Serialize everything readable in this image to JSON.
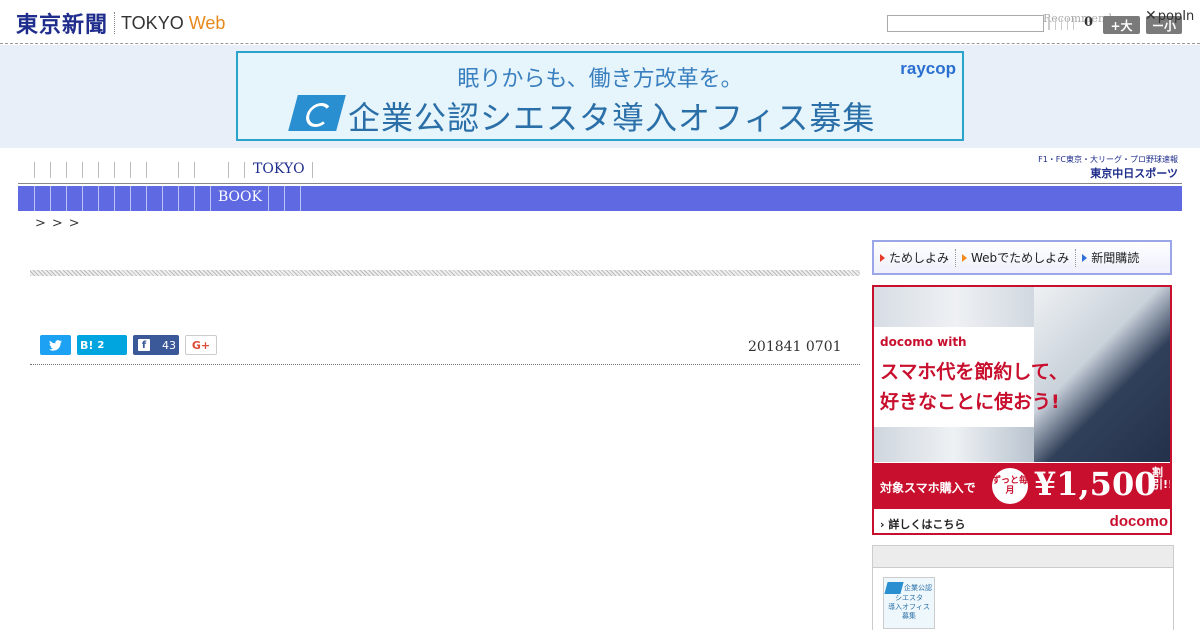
{
  "header": {
    "logo_jp": "東京新聞",
    "logo_en": "TOKYO",
    "logo_web": "Web",
    "search_value": "",
    "recommend": "Recommend",
    "count": "0",
    "size_up": "+大",
    "size_down": "ー小",
    "popin": "popIn"
  },
  "ad_top": {
    "line1": "眠りからも、働き方改革を。",
    "line2": "企業公認シエスタ導入オフィス募集",
    "brand": "raycop"
  },
  "nav": {
    "tokyo": "TOKYO",
    "book": "BOOK",
    "chunichi_line1": "F1・FC東京・大リーグ・プロ野球速報",
    "chunichi_line2": "東京中日スポーツ"
  },
  "breadcrumb": ">>>",
  "article": {
    "date": "201841 0701",
    "hatena_label": "B!",
    "hatena_count": "2",
    "facebook_count": "43",
    "google_label": "G+"
  },
  "subscribe": {
    "item1": "ためしよみ",
    "item2": "Webでためしよみ",
    "item3": "新聞購読"
  },
  "docomo_ad": {
    "brand": "docomo with",
    "copy1": "スマホ代を節約して、",
    "copy2": "好きなことに使おう!",
    "offer": "対象スマホ購入で",
    "badge": "ずっと毎月",
    "price": "¥1,500",
    "discount": "割引!!!",
    "more": "詳しくはこちら",
    "brand2": "docomo"
  },
  "side_thumb": {
    "text1": "企業公認",
    "text2": "シエスタ",
    "text3": "導入オフィス",
    "text4": "募集"
  }
}
